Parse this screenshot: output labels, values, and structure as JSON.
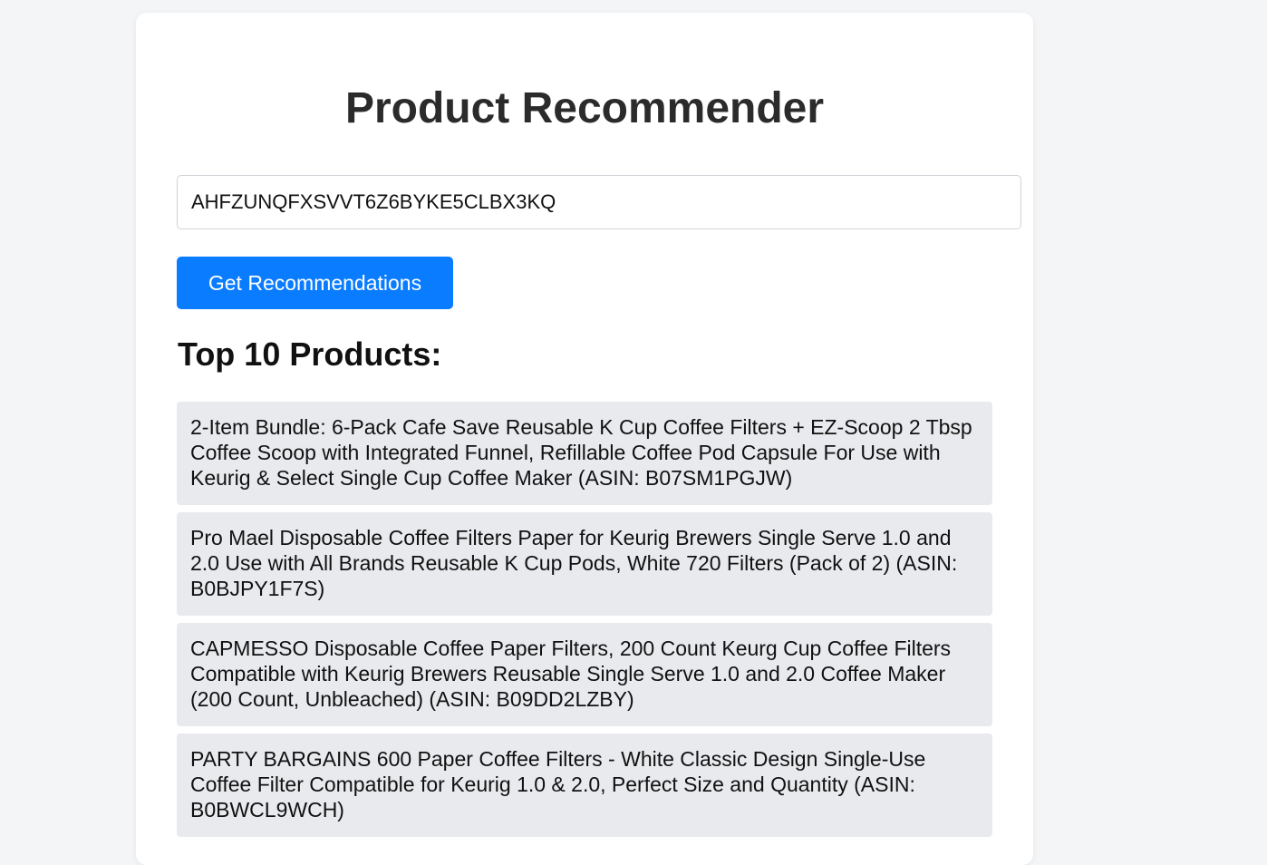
{
  "page": {
    "title": "Product Recommender"
  },
  "search": {
    "value": "AHFZUNQFXSVVT6Z6BYKE5CLBX3KQ"
  },
  "submit": {
    "label": "Get Recommendations"
  },
  "results": {
    "heading": "Top 10 Products:",
    "items": [
      {
        "text": "2-Item Bundle: 6-Pack Cafe Save Reusable K Cup Coffee Filters + EZ-Scoop 2 Tbsp Coffee Scoop with Integrated Funnel, Refillable Coffee Pod Capsule For Use with Keurig & Select Single Cup Coffee Maker (ASIN: B07SM1PGJW)"
      },
      {
        "text": "Pro Mael Disposable Coffee Filters Paper for Keurig Brewers Single Serve 1.0 and 2.0 Use with All Brands Reusable K Cup Pods, White 720 Filters (Pack of 2) (ASIN: B0BJPY1F7S)"
      },
      {
        "text": "CAPMESSO Disposable Coffee Paper Filters, 200 Count Keurg Cup Coffee Filters Compatible with Keurig Brewers Reusable Single Serve 1.0 and 2.0 Coffee Maker (200 Count, Unbleached) (ASIN: B09DD2LZBY)"
      },
      {
        "text": "PARTY BARGAINS 600 Paper Coffee Filters - White Classic Design Single-Use Coffee Filter Compatible for Keurig 1.0 & 2.0, Perfect Size and Quantity (ASIN: B0BWCL9WCH)"
      }
    ]
  },
  "colors": {
    "page_background": "#f4f5f7",
    "card_background": "#ffffff",
    "button_primary": "#0a7cff",
    "result_background": "#e8eaed"
  }
}
